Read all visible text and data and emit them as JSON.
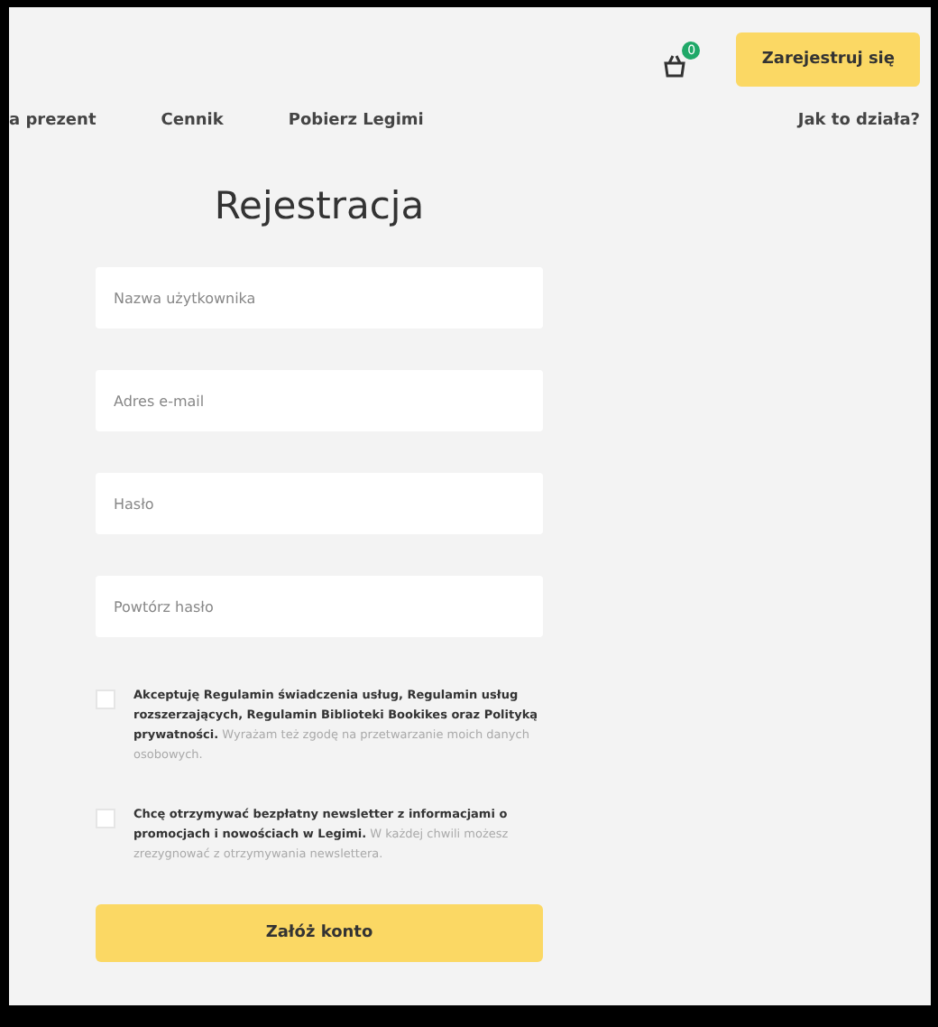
{
  "header": {
    "cart_count": "0",
    "register_button": "Zarejestruj się"
  },
  "nav": {
    "items": [
      "a prezent",
      "Cennik",
      "Pobierz Legimi"
    ],
    "help": "Jak to działa?"
  },
  "form": {
    "title": "Rejestracja",
    "fields": [
      {
        "placeholder": "Nazwa użytkownika"
      },
      {
        "placeholder": "Adres e-mail"
      },
      {
        "placeholder": "Hasło"
      },
      {
        "placeholder": "Powtórz hasło"
      }
    ],
    "consents": [
      {
        "checked": false,
        "text": "**Akceptuję Regulamin świadczenia usług, Regulamin usług rozszerzających, Regulamin Biblioteki Bookikes oraz Polityką prywatności.** Wyrażam też zgodę na przetwarzanie moich danych osobowych."
      },
      {
        "checked": false,
        "text": "**Chcę otrzymywać bezpłatny newsletter z informacjami o promocjach i nowościach w Legimi.** W każdej chwili możesz zrezygnować z otrzymywania newslettera."
      }
    ],
    "submit": "Załóż konto"
  }
}
